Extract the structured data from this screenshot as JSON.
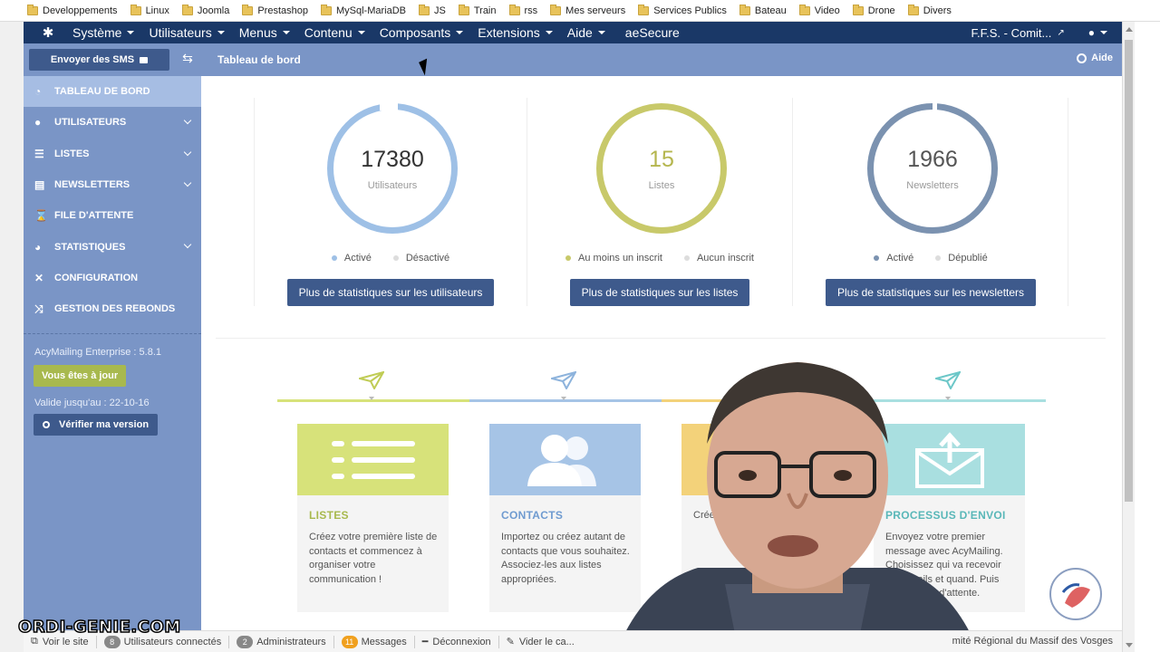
{
  "bookmarks": [
    "Developpements",
    "Linux",
    "Joomla",
    "Prestashop",
    "MySql-MariaDB",
    "JS",
    "Train",
    "rss",
    "Mes serveurs",
    "Services Publics",
    "Bateau",
    "Video",
    "Drone",
    "Divers"
  ],
  "topnav": {
    "items": [
      "Système",
      "Utilisateurs",
      "Menus",
      "Contenu",
      "Composants",
      "Extensions",
      "Aide"
    ],
    "extra": "aeSecure",
    "site": "F.F.S. - Comit..."
  },
  "subbar": {
    "sms_label": "Envoyer des SMS",
    "title": "Tableau de bord",
    "help_label": "Aide"
  },
  "sidebar": {
    "items": [
      {
        "label": "TABLEAU DE BORD",
        "icon": "dashboard-icon"
      },
      {
        "label": "UTILISATEURS",
        "icon": "users-icon"
      },
      {
        "label": "LISTES",
        "icon": "list-icon"
      },
      {
        "label": "NEWSLETTERS",
        "icon": "newsletter-icon"
      },
      {
        "label": "FILE D'ATTENTE",
        "icon": "hourglass-icon"
      },
      {
        "label": "STATISTIQUES",
        "icon": "piechart-icon"
      },
      {
        "label": "CONFIGURATION",
        "icon": "tools-icon"
      },
      {
        "label": "GESTION DES REBONDS",
        "icon": "shuffle-icon"
      }
    ],
    "version": "AcyMailing Enterprise : 5.8.1",
    "uptodate": "Vous êtes à jour",
    "valid": "Valide jusqu'au : 22-10-16",
    "verify": "Vérifier ma version"
  },
  "stats": [
    {
      "value": "17380",
      "label": "Utilisateurs",
      "legend_a": "Activé",
      "legend_b": "Désactivé",
      "button": "Plus de statistiques sur les utilisateurs",
      "color": "#9ec0e6"
    },
    {
      "value": "15",
      "label": "Listes",
      "legend_a": "Au moins un inscrit",
      "legend_b": "Aucun inscrit",
      "button": "Plus de statistiques sur les listes",
      "color": "#c8c96a"
    },
    {
      "value": "1966",
      "label": "Newsletters",
      "legend_a": "Activé",
      "legend_b": "Dépublié",
      "button": "Plus de statistiques sur les newsletters",
      "color": "#7b92b0"
    }
  ],
  "steps": [
    {
      "title": "LISTES",
      "text": "Créez votre première liste de contacts et commencez à organiser votre communication !",
      "color": "#d7e27a",
      "title_color": "#a8b94e"
    },
    {
      "title": "CONTACTS",
      "text": "Importez ou créez autant de contacts que vous souhaitez. Associez-les aux listes appropriées.",
      "color": "#a6c4e6",
      "title_color": "#6f9bd0"
    },
    {
      "title": "",
      "text": "Crée... ne...",
      "color": "#f3d27a",
      "title_color": "#e0a030"
    },
    {
      "title": "PROCESSUS D'ENVOI",
      "text": "Envoyez votre premier message avec AcyMailing. Choisissez qui va recevoir vos emails et quand. Puis gérez la file d'attente.",
      "color": "#a9dfe0",
      "title_color": "#59b7b8"
    }
  ],
  "footer": {
    "view_site": "Voir le site",
    "users_count": "8",
    "users_label": "Utilisateurs connectés",
    "admins_count": "2",
    "admins_label": "Administrateurs",
    "messages_count": "11",
    "messages_label": "Messages",
    "logout": "Déconnexion",
    "clear": "Vider le ca...",
    "right": "mité Régional du Massif des Vosges"
  },
  "watermark": "ORDI-GENIE.COM"
}
